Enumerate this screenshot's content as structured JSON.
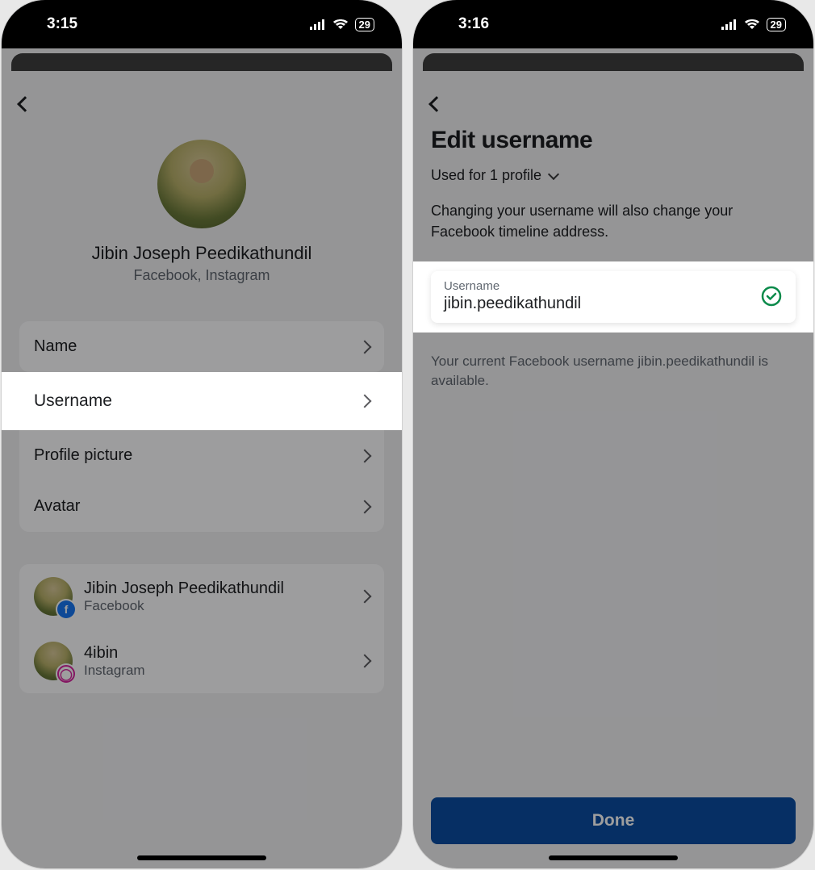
{
  "left": {
    "status": {
      "time": "3:15",
      "battery": "29"
    },
    "profile": {
      "display_name": "Jibin Joseph Peedikathundil",
      "apps_sub": "Facebook, Instagram"
    },
    "rows": {
      "name": "Name",
      "username": "Username",
      "profile_picture": "Profile picture",
      "avatar": "Avatar"
    },
    "accounts": [
      {
        "name": "Jibin Joseph Peedikathundil",
        "platform": "Facebook",
        "badge": "fb"
      },
      {
        "name": "4ibin",
        "platform": "Instagram",
        "badge": "ig"
      }
    ]
  },
  "right": {
    "status": {
      "time": "3:16",
      "battery": "29"
    },
    "title": "Edit username",
    "used_for": "Used for 1 profile",
    "description": "Changing your username will also change your Facebook timeline address.",
    "field": {
      "label": "Username",
      "value": "jibin.peedikathundil"
    },
    "helper": "Your current Facebook username jibin.peedikathundil is available.",
    "done_label": "Done"
  }
}
